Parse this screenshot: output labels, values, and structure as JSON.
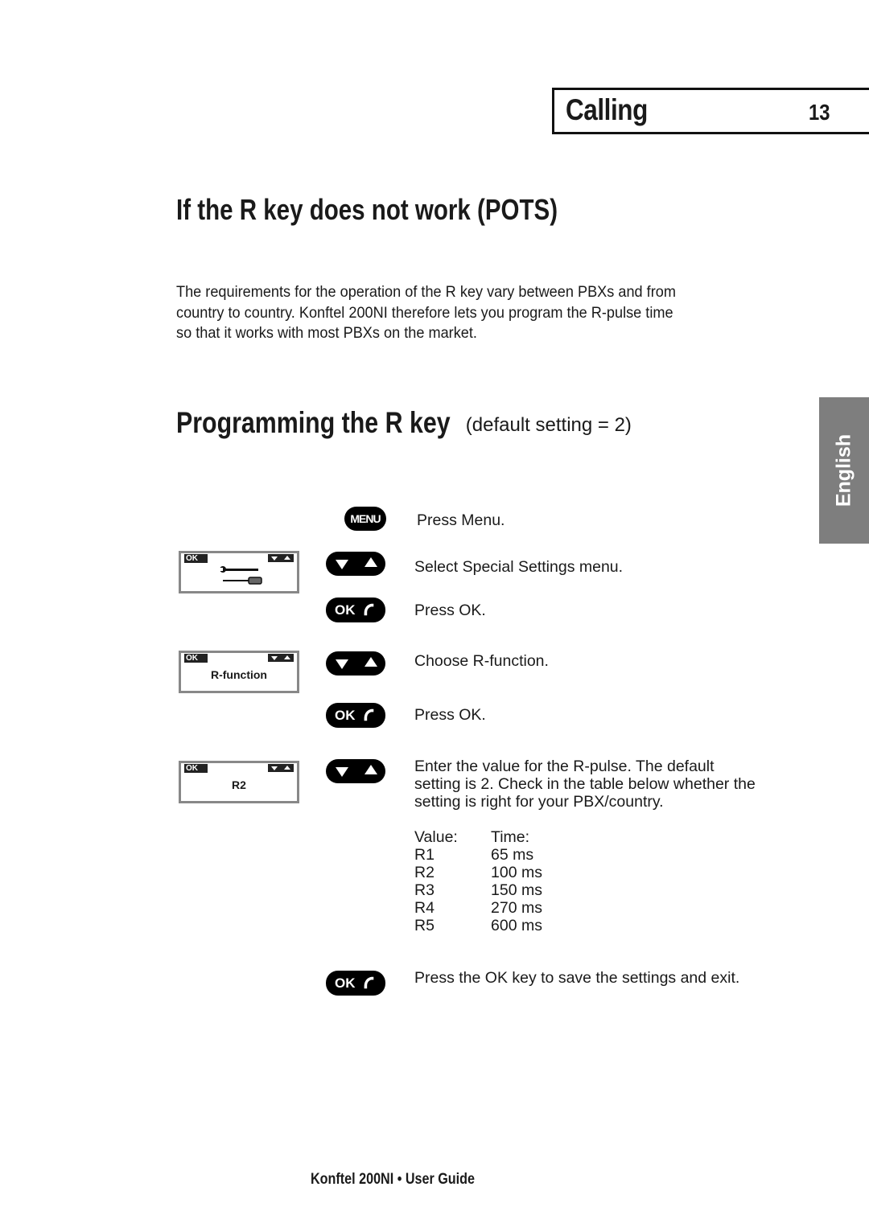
{
  "header": {
    "section": "Calling",
    "page_number": "13"
  },
  "title": "If the R key does not work (POTS)",
  "intro": "The requirements for the operation of the R key vary between PBXs and from country to country. Konftel 200NI therefore lets you program the R-pulse time so that it works with most PBXs on the market.",
  "subheading": {
    "main": "Programming the R key",
    "note": "(default setting = 2)"
  },
  "language_tab": "English",
  "buttons": {
    "menu": "MENU",
    "ok": "OK"
  },
  "displays": [
    {
      "ok_label": "OK",
      "content": "tools-icon"
    },
    {
      "ok_label": "OK",
      "content": "R-function"
    },
    {
      "ok_label": "OK",
      "content": "R2"
    }
  ],
  "steps": [
    {
      "key": "menu",
      "text": "Press Menu."
    },
    {
      "key": "nav",
      "text": "Select Special Settings menu."
    },
    {
      "key": "ok",
      "text": "Press OK."
    },
    {
      "key": "nav",
      "text": "Choose R-function."
    },
    {
      "key": "ok",
      "text": "Press OK."
    },
    {
      "key": "nav",
      "text": "Enter the value for the R-pulse. The default setting is 2. Check in the table below whether the setting is right for your PBX/country."
    },
    {
      "key": "ok",
      "text": "Press the OK key to save the settings and exit."
    }
  ],
  "r_table": {
    "headers": [
      "Value:",
      "Time:"
    ],
    "rows": [
      [
        "R1",
        "65 ms"
      ],
      [
        "R2",
        "100 ms"
      ],
      [
        "R3",
        "150 ms"
      ],
      [
        "R4",
        "270 ms"
      ],
      [
        "R5",
        "600 ms"
      ]
    ]
  },
  "footer": "Konftel 200NI • User Guide"
}
